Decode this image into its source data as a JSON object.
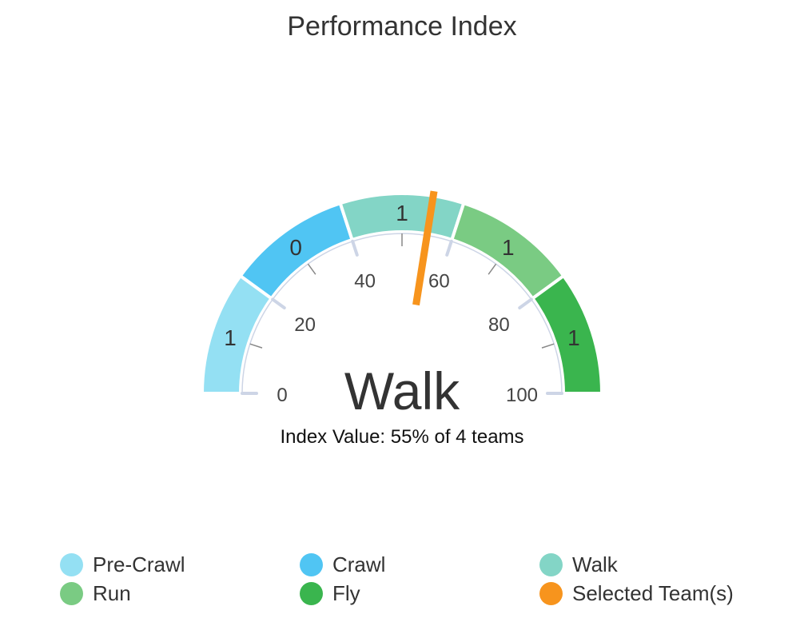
{
  "chart_data": {
    "type": "gauge",
    "title": "Performance Index",
    "range": [
      0,
      100
    ],
    "ticks": [
      0,
      20,
      40,
      60,
      80,
      100
    ],
    "bands": [
      {
        "name": "Pre-Crawl",
        "from": 0,
        "to": 20,
        "count": "1",
        "color": "#94E0F3"
      },
      {
        "name": "Crawl",
        "from": 20,
        "to": 40,
        "count": "0",
        "color": "#50C5F3"
      },
      {
        "name": "Walk",
        "from": 40,
        "to": 60,
        "count": "1",
        "color": "#83D5C6"
      },
      {
        "name": "Run",
        "from": 60,
        "to": 80,
        "count": "1",
        "color": "#7ACB83"
      },
      {
        "name": "Fly",
        "from": 80,
        "to": 100,
        "count": "1",
        "color": "#3AB54E"
      }
    ],
    "pointer": {
      "name": "Selected Team(s)",
      "value": 55,
      "color": "#F7941D"
    },
    "center_label": "Walk",
    "sub_label": "Index Value: 55% of 4 teams"
  },
  "legend": [
    {
      "label": "Pre-Crawl",
      "color": "#94E0F3"
    },
    {
      "label": "Crawl",
      "color": "#50C5F3"
    },
    {
      "label": "Walk",
      "color": "#83D5C6"
    },
    {
      "label": "Run",
      "color": "#7ACB83"
    },
    {
      "label": "Fly",
      "color": "#3AB54E"
    },
    {
      "label": "Selected Team(s)",
      "color": "#F7941D"
    }
  ]
}
